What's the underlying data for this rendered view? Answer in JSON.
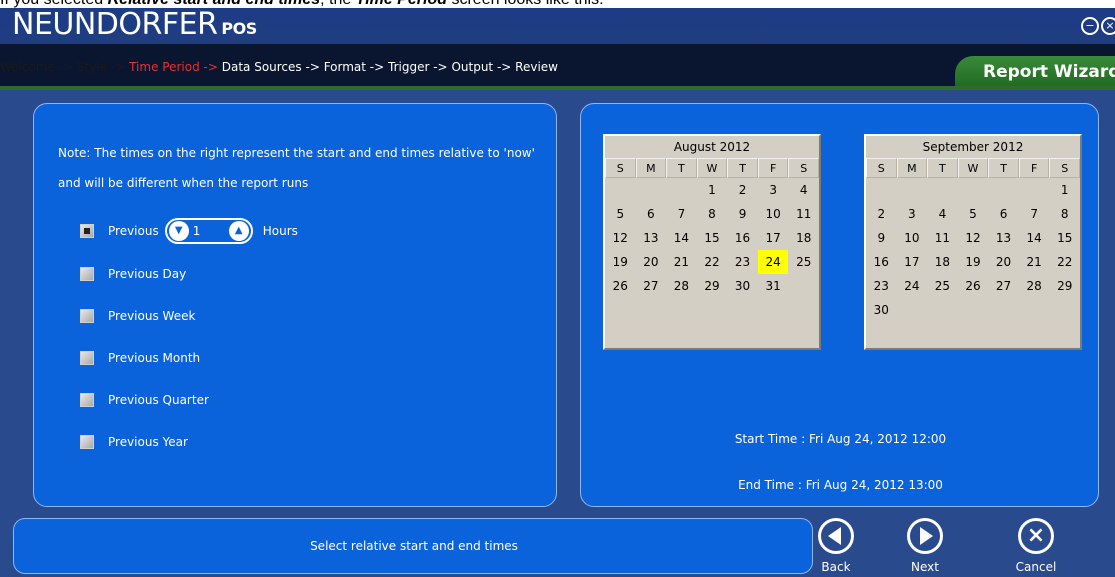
{
  "caption": {
    "prefix": "If you selected ",
    "emphasis": "Relative start and end times",
    "middle": ", the ",
    "emphasis2": "Time Period",
    "suffix": " screen looks like this:"
  },
  "app": {
    "brand": "NEUNDORFER",
    "brand_sub": "POS",
    "minimize_glyph": "−",
    "close_glyph": "×"
  },
  "breadcrumb": {
    "items": [
      {
        "label": "Welcome ->",
        "state": "done"
      },
      {
        "label": "Style ->",
        "state": "done"
      },
      {
        "label": "Time Period ->",
        "state": "active"
      },
      {
        "label": "Data Sources ->",
        "state": "pending"
      },
      {
        "label": "Format ->",
        "state": "pending"
      },
      {
        "label": "Trigger ->",
        "state": "pending"
      },
      {
        "label": "Output ->",
        "state": "pending"
      },
      {
        "label": "Review",
        "state": "pending"
      }
    ],
    "wizard_tab": "Report Wizard"
  },
  "left_panel": {
    "note": "Note: The times on the right represent the start and end times relative to 'now' and will be different when the report runs",
    "options": [
      {
        "label": "Previous",
        "checked": true,
        "stepper_value": "1",
        "unit": "Hours"
      },
      {
        "label": "Previous Day",
        "checked": false
      },
      {
        "label": "Previous Week",
        "checked": false
      },
      {
        "label": "Previous Month",
        "checked": false
      },
      {
        "label": "Previous Quarter",
        "checked": false
      },
      {
        "label": "Previous Year",
        "checked": false
      }
    ],
    "stepper_down_glyph": "▼",
    "stepper_up_glyph": "▲"
  },
  "calendars": [
    {
      "title": "August 2012",
      "weekdays": [
        "S",
        "M",
        "T",
        "W",
        "T",
        "F",
        "S"
      ],
      "first_weekday": 3,
      "days": 31,
      "highlight": 24
    },
    {
      "title": "September 2012",
      "weekdays": [
        "S",
        "M",
        "T",
        "W",
        "T",
        "F",
        "S"
      ],
      "first_weekday": 6,
      "days": 30,
      "highlight": null
    }
  ],
  "times": {
    "start": "Start Time : Fri Aug 24, 2012 12:00",
    "end": "End Time : Fri Aug 24, 2012 13:00"
  },
  "status": {
    "text": "Select relative start and end times"
  },
  "nav": {
    "back": "Back",
    "next": "Next",
    "cancel": "Cancel"
  },
  "colors": {
    "panel": "#0b63dc",
    "background": "#2a4a8e",
    "crumb_active": "#e53030",
    "calendar_bg": "#d4cfc4",
    "highlight": "#ffff00",
    "wizard_tab": "#2f7a2f"
  }
}
